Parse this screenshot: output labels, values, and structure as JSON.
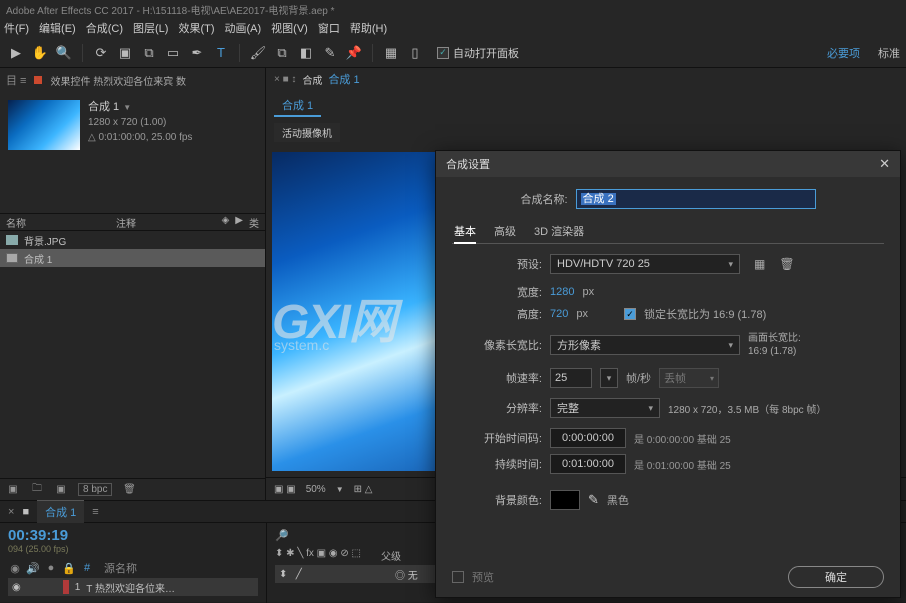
{
  "title": "Adobe After Effects CC 2017 - H:\\151118-电视\\AE\\AE2017-电视背景.aep *",
  "menu": {
    "file": "件(F)",
    "edit": "编辑(E)",
    "comp": "合成(C)",
    "layer": "图层(L)",
    "effect": "效果(T)",
    "anim": "动画(A)",
    "view": "视图(V)",
    "window": "窗口",
    "help": "帮助(H)"
  },
  "toolbar": {
    "auto_open": "自动打开面板",
    "essentials": "必要项",
    "standard": "标准"
  },
  "project": {
    "panel_label": "效果控件 热烈欢迎各位来宾 数",
    "comp_name": "合成 1",
    "dims": "1280 x 720 (1.00)",
    "dur": "0:01:00:00, 25.00 fps",
    "col_name": "名称",
    "col_note": "注释",
    "col_type": "类",
    "items": [
      {
        "name": "背景.JPG",
        "type": "jpg"
      },
      {
        "name": "合成 1",
        "type": "comp",
        "selected": true
      }
    ],
    "bpc": "8 bpc"
  },
  "viewer": {
    "group_label": "合成",
    "link_name": "合成 1",
    "sub_tab": "合成 1",
    "camera": "活动摄像机",
    "zoom": "50%",
    "wm1": "GXI网",
    "wm2": "system.c"
  },
  "timeline": {
    "tab": "合成 1",
    "tc": "00:39:19",
    "tc2": "094 (25.00 fps)",
    "src_col": "源名称",
    "src_item": "T  热烈欢迎各位来…",
    "parent_col": "父级",
    "none": "无",
    "num": "1"
  },
  "dialog": {
    "title": "合成设置",
    "name_label": "合成名称:",
    "name_value": "合成 2",
    "tab_basic": "基本",
    "tab_adv": "高级",
    "tab_3d": "3D 渲染器",
    "preset_label": "预设:",
    "preset_value": "HDV/HDTV 720 25",
    "w_label": "宽度:",
    "w_value": "1280",
    "h_label": "高度:",
    "h_value": "720",
    "px": "px",
    "lock_label": "锁定长宽比为 16:9 (1.78)",
    "par_label": "像素长宽比:",
    "par_value": "方形像素",
    "par_meta1": "画面长宽比:",
    "par_meta2": "16:9 (1.78)",
    "fps_label": "帧速率:",
    "fps_value": "25",
    "fps_unit": "帧/秒",
    "fps_drop": "丢帧",
    "res_label": "分辨率:",
    "res_value": "完整",
    "res_info": "1280 x 720，3.5 MB（每 8bpc 帧）",
    "start_label": "开始时间码:",
    "start_value": "0:00:00:00",
    "start_info": "是 0:00:00:00  基础 25",
    "dur_label": "持续时间:",
    "dur_value": "0:01:00:00",
    "dur_info": "是 0:01:00:00  基础 25",
    "bg_label": "背景颜色:",
    "bg_name": "黑色",
    "preview": "预览",
    "ok": "确定"
  }
}
